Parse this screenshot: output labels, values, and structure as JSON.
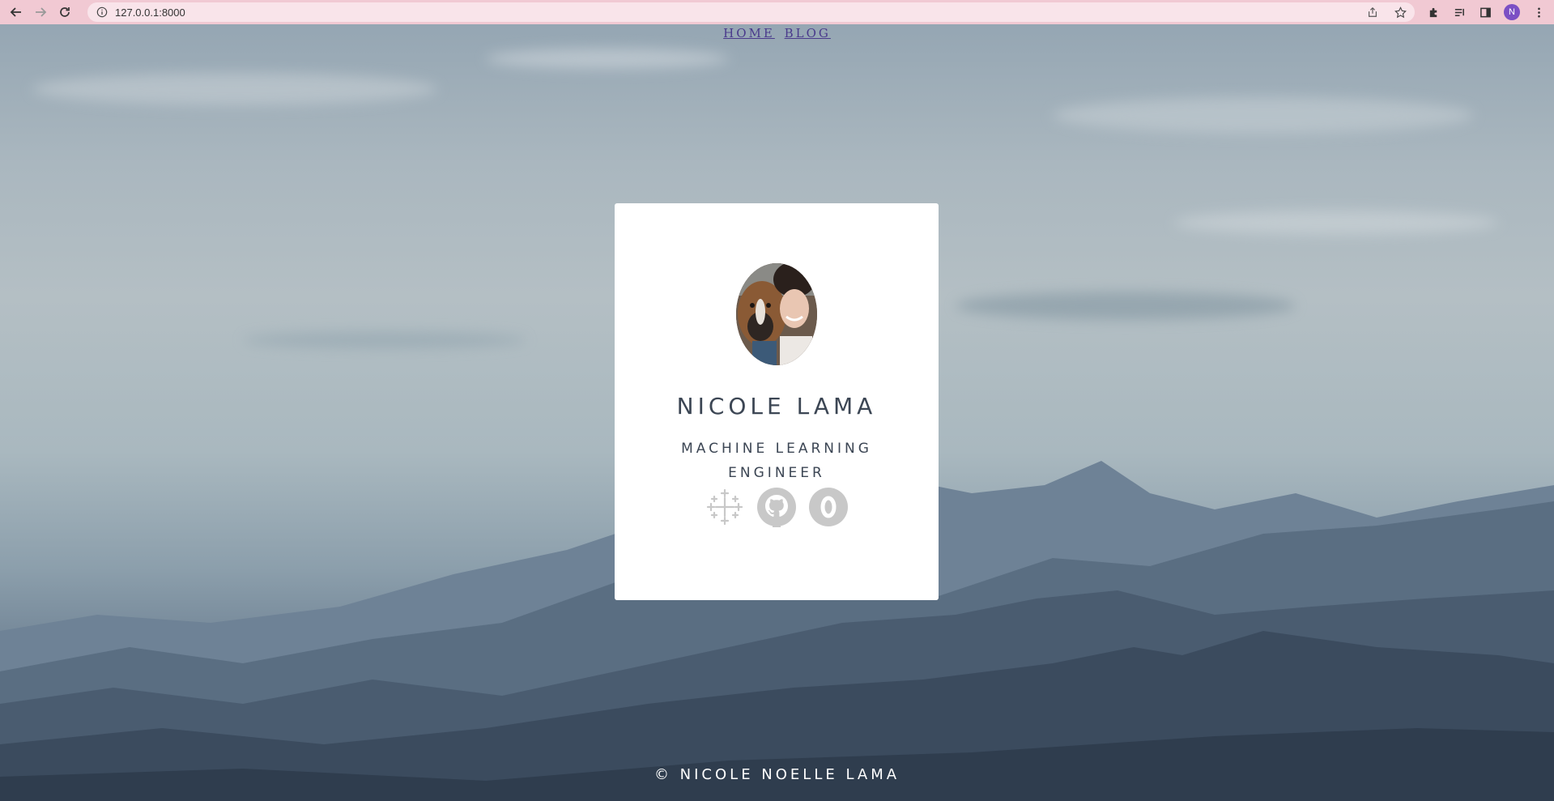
{
  "browser": {
    "url": "127.0.0.1:8000",
    "profile_initial": "N",
    "icons": [
      "back-icon",
      "forward-icon",
      "reload-icon",
      "info-icon",
      "share-icon",
      "star-icon",
      "extensions-icon",
      "reading-list-icon",
      "side-panel-icon",
      "menu-icon"
    ]
  },
  "nav": {
    "home": "HOME",
    "blog": "BLOG"
  },
  "card": {
    "name": "NICOLE LAMA",
    "title_line1": "MACHINE LEARNING",
    "title_line2": "ENGINEER",
    "socials": [
      "tableau-icon",
      "github-icon",
      "orcid-icon"
    ]
  },
  "footer": {
    "text": "© NICOLE NOELLE LAMA"
  },
  "colors": {
    "browser_bar": "#f1c9d3",
    "link": "#4a3a8c",
    "card_text": "#3c4654",
    "social_icon": "#c8c8c8"
  }
}
